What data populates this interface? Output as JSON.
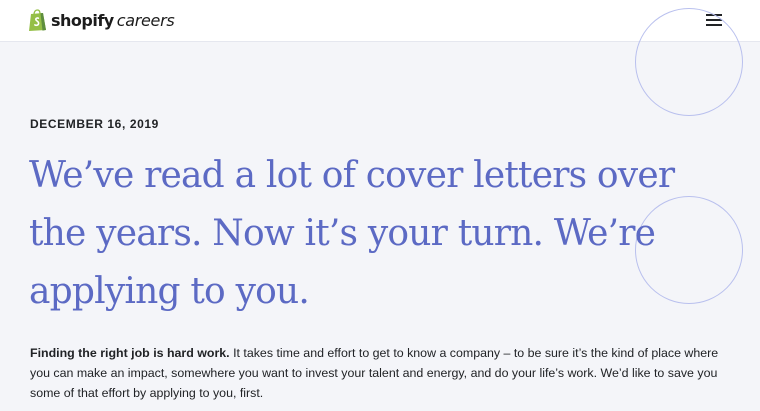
{
  "header": {
    "brand": "shopify",
    "brand_sub": "careers",
    "menu_icon": "hamburger-menu-icon"
  },
  "colors": {
    "accent": "#5c6ac4",
    "brand_green": "#95bf47",
    "background": "#f4f5f9"
  },
  "article": {
    "date": "DECEMBER 16, 2019",
    "headline": "We’ve read a lot of cover letters over the years. Now it’s your turn. We’re applying to you.",
    "intro_lead": "Finding the right job is hard work.",
    "intro_body": " It takes time and effort to get to know a company – to be sure it’s the kind of place where you can make an impact, somewhere you want to invest your talent and energy, and do your life’s work. We’d like to save you some of that effort by applying to you, first."
  }
}
